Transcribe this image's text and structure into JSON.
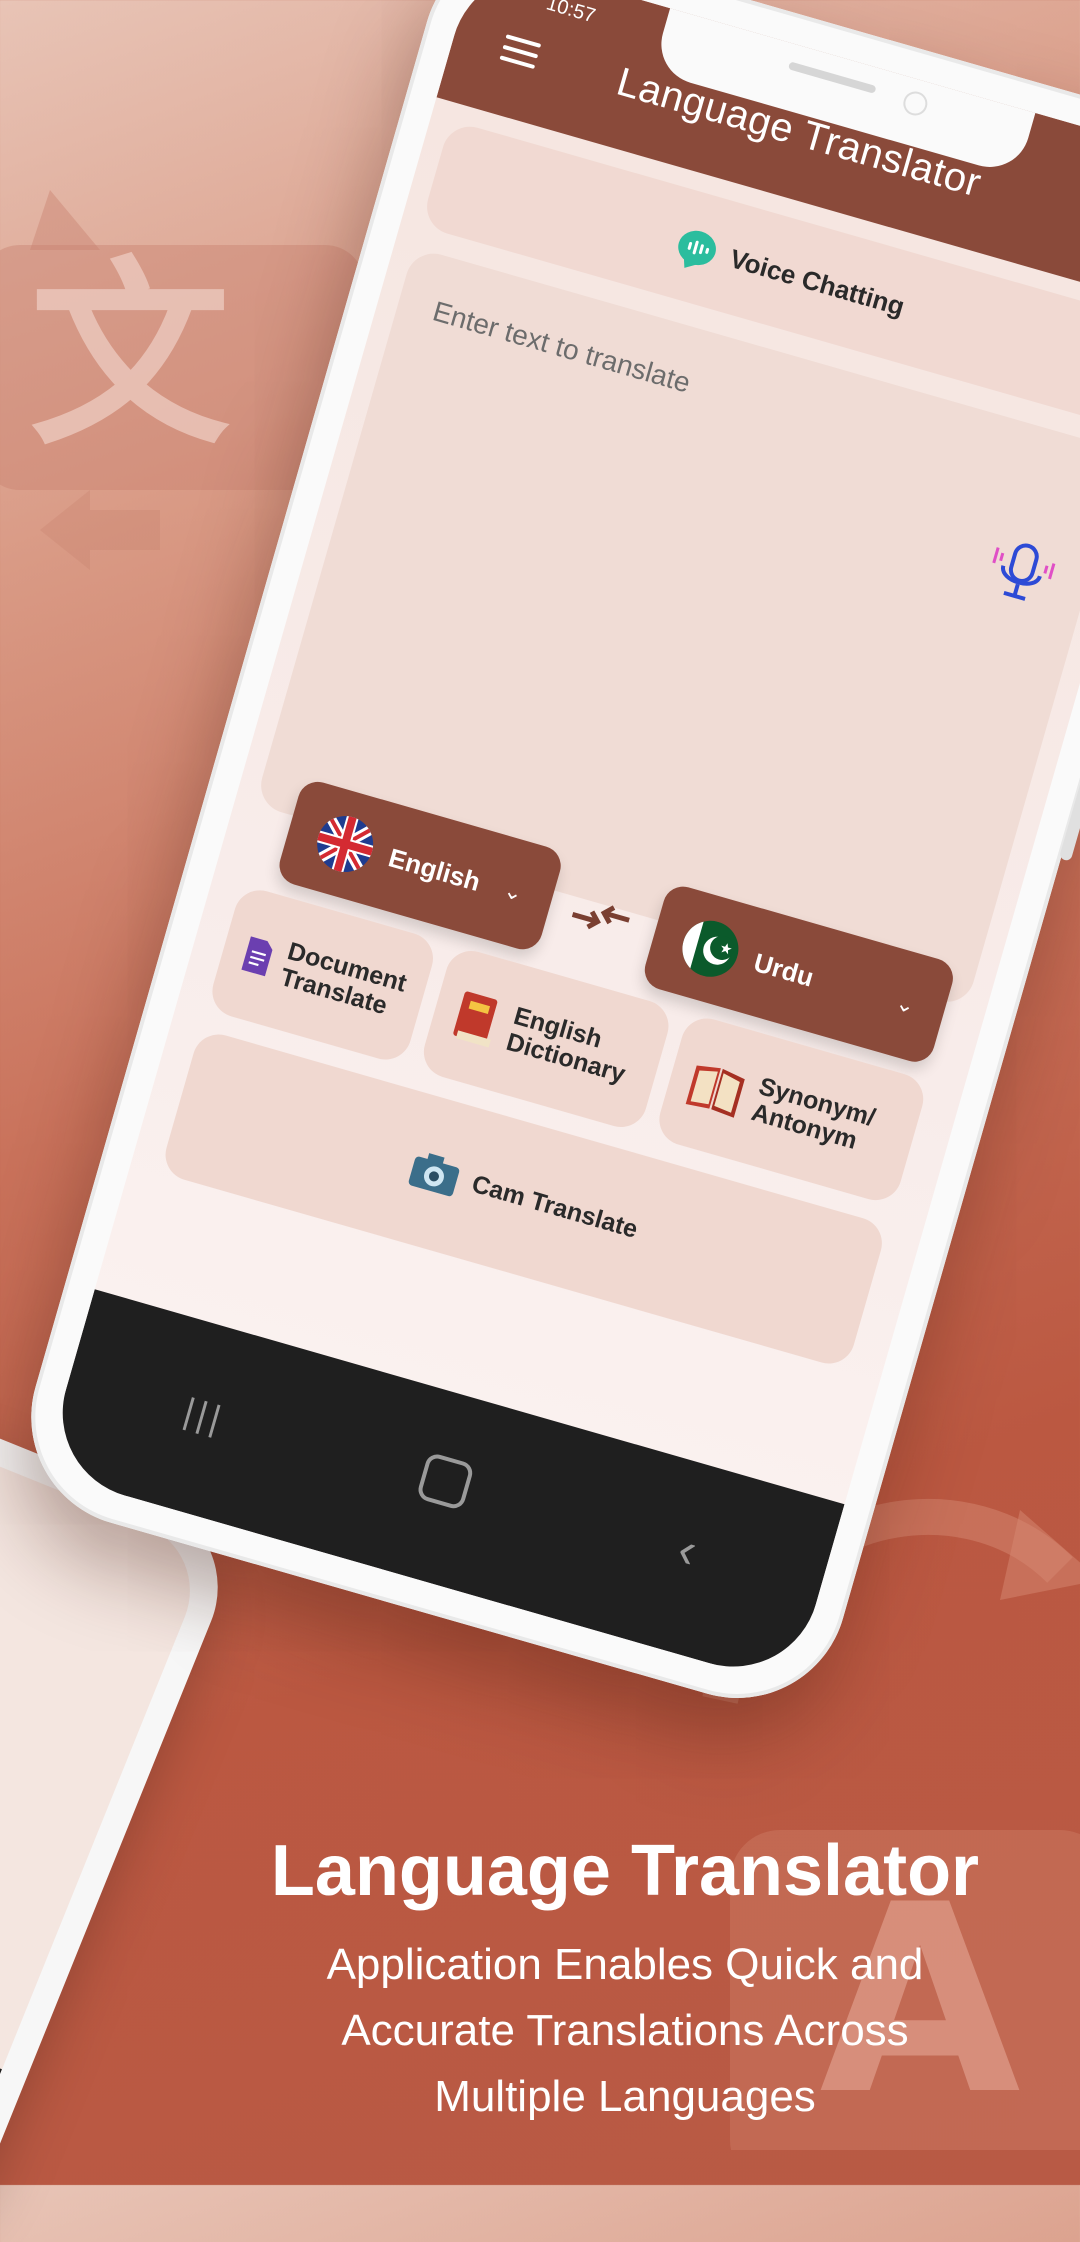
{
  "status_bar": {
    "time": "10:57"
  },
  "app_bar": {
    "title": "Language Translator",
    "menu_icon": "hamburger-menu-icon"
  },
  "voice_chat": {
    "label": "Voice Chatting",
    "icon": "voice-chat-icon"
  },
  "input": {
    "placeholder": "Enter text to translate",
    "mic_icon": "microphone-icon"
  },
  "languages": {
    "source": {
      "name": "English",
      "flag": "uk-flag-icon"
    },
    "target": {
      "name": "Urdu",
      "flag": "pakistan-flag-icon"
    },
    "swap_icon": "swap-arrows-icon"
  },
  "features": {
    "document": {
      "label_line1": "Document",
      "label_line2": "Translate",
      "icon": "document-icon"
    },
    "dictionary": {
      "label_line1": "English",
      "label_line2": "Dictionary",
      "icon": "book-icon"
    },
    "synonym": {
      "label_line1": "Synonym/",
      "label_line2": "Antonym",
      "icon": "open-book-icon"
    },
    "camera": {
      "label": "Cam Translate",
      "icon": "camera-icon"
    }
  },
  "caption": {
    "title": "Language Translator",
    "line1": "Application Enables Quick and",
    "line2": "Accurate Translations Across",
    "line3": "Multiple Languages"
  },
  "colors": {
    "brand": "#8a4a3a",
    "card": "#f1d9d2",
    "background": "#bb5841"
  }
}
